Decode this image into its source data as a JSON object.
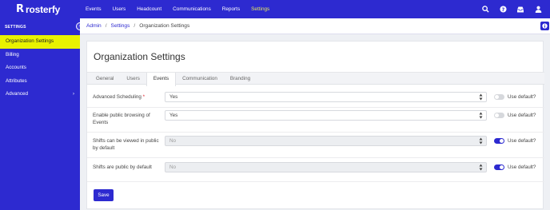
{
  "brand": {
    "name": "rosterfy",
    "logo_glyph": "R"
  },
  "topnav": {
    "items": [
      {
        "label": "Events"
      },
      {
        "label": "Users"
      },
      {
        "label": "Headcount"
      },
      {
        "label": "Communications"
      },
      {
        "label": "Reports"
      },
      {
        "label": "Settings",
        "active": true
      }
    ],
    "icons": [
      "search-icon",
      "help-icon",
      "inbox-icon",
      "user-icon"
    ]
  },
  "sidebar": {
    "heading": "SETTINGS",
    "items": [
      {
        "label": "Organization Settings",
        "active": true
      },
      {
        "label": "Billing"
      },
      {
        "label": "Accounts"
      },
      {
        "label": "Attributes"
      },
      {
        "label": "Advanced",
        "has_submenu": true
      }
    ]
  },
  "breadcrumb": {
    "items": [
      "Admin",
      "Settings",
      "Organization Settings"
    ],
    "separator": "/"
  },
  "page": {
    "title": "Organization Settings"
  },
  "tabs": [
    {
      "label": "General"
    },
    {
      "label": "Users"
    },
    {
      "label": "Events",
      "active": true
    },
    {
      "label": "Communication"
    },
    {
      "label": "Branding"
    }
  ],
  "settings": [
    {
      "label": "Advanced Scheduling",
      "required": true,
      "value": "Yes",
      "disabled": false,
      "use_default": false,
      "use_default_label": "Use default?"
    },
    {
      "label": "Enable public browsing of Events",
      "required": false,
      "value": "Yes",
      "disabled": false,
      "use_default": false,
      "use_default_label": "Use default?"
    },
    {
      "label": "Shifts can be viewed in public by default",
      "required": false,
      "value": "No",
      "disabled": true,
      "use_default": true,
      "use_default_label": "Use default?"
    },
    {
      "label": "Shifts are public by default",
      "required": false,
      "value": "No",
      "disabled": true,
      "use_default": true,
      "use_default_label": "Use default?"
    }
  ],
  "actions": {
    "save_label": "Save"
  },
  "colors": {
    "primary": "#2d2ad0",
    "active_sidebar": "#e9f200",
    "active_topnav": "#e6e85a",
    "required": "#e0202a"
  }
}
